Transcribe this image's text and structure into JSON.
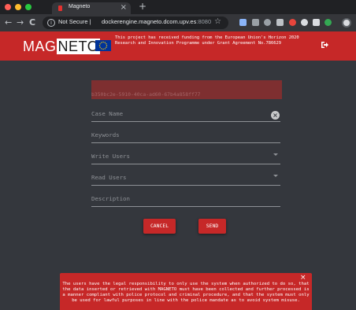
{
  "browser": {
    "tab_title": "Magneto",
    "close_tab": "×",
    "new_tab": "+",
    "back": "←",
    "forward": "→",
    "reload": "C",
    "info": "i",
    "security_label": "Not Secure",
    "separator": "|",
    "url_host": "dockerengine.magneto.dcom.upv.es",
    "url_port": ":8080",
    "star": "☆"
  },
  "header": {
    "logo_part1": "MAG",
    "logo_part2": "NETO",
    "funding_text": "This project has received funding from the European Union's Horizon 2020 Research and Innovation Programme under Grant Agreement No.786629"
  },
  "form": {
    "case_id": "b350bc2e-5910-40ca-ad60-67b4a858ff77",
    "case_name_placeholder": "Case Name",
    "keywords_placeholder": "Keywords",
    "write_users_placeholder": "Write Users",
    "read_users_placeholder": "Read Users",
    "description_placeholder": "Description",
    "clear": "×",
    "cancel_label": "CANCEL",
    "send_label": "SEND"
  },
  "disclaimer": {
    "close": "×",
    "text": "The users have the legal responsibility to only use the system when authorized to do so, that the data inserted or retrieved with MAGNETO must have been collected and further processed is a manner compliant with police protocol and criminal procedure, and that the system must only be used for lawful purposes in line with the police mandate as to avoid system misuse."
  },
  "colors": {
    "brand_red": "#c62828",
    "background": "#34373d",
    "id_field": "#7e2f30"
  }
}
